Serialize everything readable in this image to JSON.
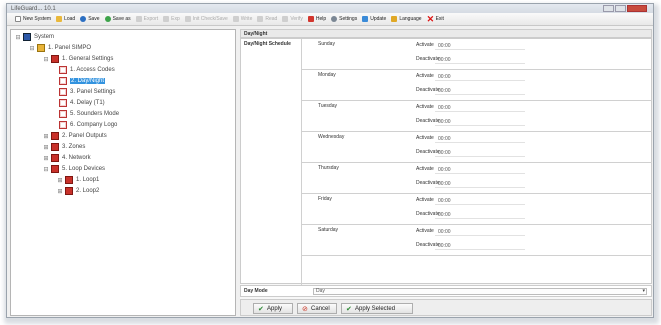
{
  "window": {
    "title": "LifeGuard... 10.1"
  },
  "toolbar": {
    "items": [
      {
        "label": "New System",
        "icon": "new-file-icon",
        "enabled": true
      },
      {
        "label": "Load",
        "icon": "folder-icon",
        "enabled": true
      },
      {
        "label": "Save",
        "icon": "save-icon",
        "enabled": true
      },
      {
        "label": "Save as",
        "icon": "save-as-icon",
        "enabled": true
      },
      {
        "label": "Export",
        "icon": "export-icon",
        "enabled": false
      },
      {
        "label": "Exp",
        "icon": "exp-icon",
        "enabled": false
      },
      {
        "label": "Init Check/Save",
        "icon": "check-icon",
        "enabled": false
      },
      {
        "label": "Write",
        "icon": "write-icon",
        "enabled": false
      },
      {
        "label": "Read",
        "icon": "read-icon",
        "enabled": false
      },
      {
        "label": "Verify",
        "icon": "verify-icon",
        "enabled": false
      },
      {
        "label": "Help",
        "icon": "help-icon",
        "enabled": true
      },
      {
        "label": "Settings",
        "icon": "gear-icon",
        "enabled": true
      },
      {
        "label": "Update",
        "icon": "update-icon",
        "enabled": true
      },
      {
        "label": "Language",
        "icon": "flag-icon",
        "enabled": true
      },
      {
        "label": "Exit",
        "icon": "exit-icon",
        "enabled": true
      }
    ]
  },
  "tree": {
    "nodes": [
      {
        "label": "System",
        "expander": "⊟",
        "icon": "system-icon"
      },
      {
        "label": "1. Panel SIMPO",
        "expander": "⊟",
        "icon": "panel-icon"
      },
      {
        "label": "1. General Settings",
        "expander": "⊟",
        "icon": "folder-icon"
      },
      {
        "label": "1. Access Codes",
        "expander": "",
        "icon": "page-icon"
      },
      {
        "label": "2. Day/Night",
        "expander": "",
        "icon": "page-icon",
        "selected": true
      },
      {
        "label": "3. Panel Settings",
        "expander": "",
        "icon": "page-icon"
      },
      {
        "label": "4. Delay (T1)",
        "expander": "",
        "icon": "page-icon"
      },
      {
        "label": "5. Sounders Mode",
        "expander": "",
        "icon": "page-icon"
      },
      {
        "label": "6. Company Logo",
        "expander": "",
        "icon": "page-icon"
      },
      {
        "label": "2. Panel Outputs",
        "expander": "⊞",
        "icon": "folder-icon"
      },
      {
        "label": "3. Zones",
        "expander": "⊞",
        "icon": "folder-icon"
      },
      {
        "label": "4. Network",
        "expander": "⊞",
        "icon": "folder-icon"
      },
      {
        "label": "5. Loop Devices",
        "expander": "⊟",
        "icon": "folder-icon"
      },
      {
        "label": "1. Loop1",
        "expander": "⊞",
        "icon": "loop-icon"
      },
      {
        "label": "2. Loop2",
        "expander": "⊞",
        "icon": "loop-icon"
      }
    ]
  },
  "panel": {
    "tab_title": "Day/Night",
    "schedule_label": "Day/Night Schedule",
    "activate_label": "Activate",
    "deactivate_label": "Deactivate",
    "days": [
      {
        "name": "Sunday",
        "activate": "00:00",
        "deactivate": "00:00"
      },
      {
        "name": "Monday",
        "activate": "00:00",
        "deactivate": "00:00"
      },
      {
        "name": "Tuesday",
        "activate": "00:00",
        "deactivate": "00:00"
      },
      {
        "name": "Wednesday",
        "activate": "00:00",
        "deactivate": "00:00"
      },
      {
        "name": "Thursday",
        "activate": "00:00",
        "deactivate": "00:00"
      },
      {
        "name": "Friday",
        "activate": "00:00",
        "deactivate": "00:00"
      },
      {
        "name": "Saturday",
        "activate": "00:00",
        "deactivate": "00:00"
      }
    ],
    "day_mode_label": "Day Mode",
    "day_mode_value": "Day",
    "dropdown_arrow": "▾"
  },
  "footer": {
    "apply": "Apply",
    "cancel": "Cancel",
    "apply_selected": "Apply Selected",
    "ok_glyph": "✔",
    "cancel_glyph": "⊘"
  }
}
